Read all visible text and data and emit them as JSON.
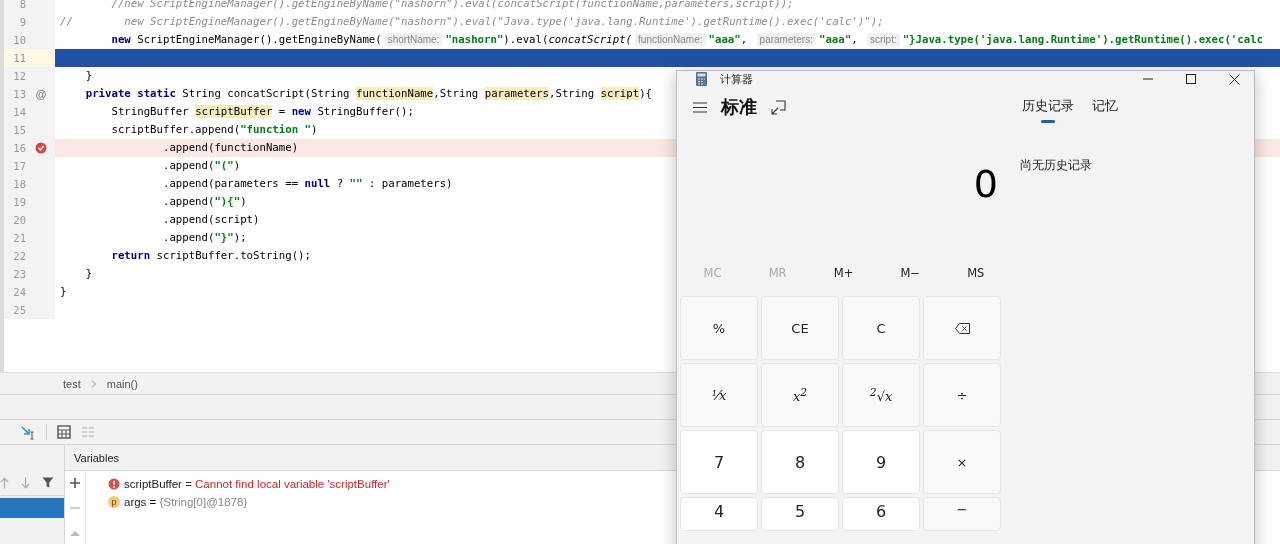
{
  "editor": {
    "lines": [
      {
        "number": "8",
        "kind": "plain",
        "tokens": [
          {
            "kind": "comment",
            "text": "        //new ScriptEngineManager().getEngineByName(\"nashorn\").eval(concatScript(functionName,parameters,script));"
          }
        ]
      },
      {
        "number": "9",
        "kind": "plain",
        "tokens": [
          {
            "kind": "comment",
            "text": "//        new ScriptEngineManager().getEngineByName(\"nashorn\").eval(\"Java.type('java.lang.Runtime').getRuntime().exec('calc')\");"
          }
        ]
      },
      {
        "number": "10",
        "kind": "plain",
        "tokens": [
          {
            "kind": "keyword",
            "text": "        new"
          },
          {
            "kind": "plain",
            "text": " ScriptEngineManager().getEngineByName("
          },
          {
            "kind": "hint",
            "text": "shortName:"
          },
          {
            "kind": "string",
            "text": "\"nashorn\""
          },
          {
            "kind": "plain",
            "text": ").eval("
          },
          {
            "kind": "italic",
            "text": "concatScript("
          },
          {
            "kind": "hint",
            "text": "functionName:"
          },
          {
            "kind": "string",
            "text": "\"aaa\""
          },
          {
            "kind": "plain",
            "text": ", "
          },
          {
            "kind": "hint",
            "text": "parameters:"
          },
          {
            "kind": "string",
            "text": "\"aaa\""
          },
          {
            "kind": "plain",
            "text": ", "
          },
          {
            "kind": "hint",
            "text": "script:"
          },
          {
            "kind": "string",
            "text": "\"}Java.type('java.lang.Runtime').getRuntime().exec('calc"
          }
        ]
      },
      {
        "number": "11",
        "kind": "current"
      },
      {
        "number": "12",
        "kind": "plain",
        "tokens": [
          {
            "kind": "plain",
            "text": "    }"
          }
        ]
      },
      {
        "number": "13",
        "kind": "plain",
        "gutter_text": "@",
        "tokens": [
          {
            "kind": "keyword",
            "text": "    private static"
          },
          {
            "kind": "plain",
            "text": " String concatScript(String "
          },
          {
            "kind": "highlight",
            "text": "functionName"
          },
          {
            "kind": "plain",
            "text": ",String "
          },
          {
            "kind": "highlight",
            "text": "parameters"
          },
          {
            "kind": "plain",
            "text": ",String "
          },
          {
            "kind": "highlight",
            "text": "script"
          },
          {
            "kind": "plain",
            "text": "){"
          }
        ]
      },
      {
        "number": "14",
        "kind": "plain",
        "tokens": [
          {
            "kind": "plain",
            "text": "        StringBuffer "
          },
          {
            "kind": "highlight",
            "text": "scriptBuffer"
          },
          {
            "kind": "plain",
            "text": " = "
          },
          {
            "kind": "keyword",
            "text": "new"
          },
          {
            "kind": "plain",
            "text": " StringBuffer();"
          }
        ]
      },
      {
        "number": "15",
        "kind": "plain",
        "tokens": [
          {
            "kind": "plain",
            "text": "        scriptBuffer.append("
          },
          {
            "kind": "string",
            "text": "\"function \""
          },
          {
            "kind": "plain",
            "text": ")"
          }
        ]
      },
      {
        "number": "16",
        "kind": "breakpoint",
        "tokens": [
          {
            "kind": "plain",
            "text": "                .append(functionName)"
          }
        ]
      },
      {
        "number": "17",
        "kind": "plain",
        "tokens": [
          {
            "kind": "plain",
            "text": "                .append("
          },
          {
            "kind": "string",
            "text": "\"(\""
          },
          {
            "kind": "plain",
            "text": ")"
          }
        ]
      },
      {
        "number": "18",
        "kind": "plain",
        "tokens": [
          {
            "kind": "plain",
            "text": "                .append(parameters == "
          },
          {
            "kind": "keyword",
            "text": "null"
          },
          {
            "kind": "plain",
            "text": " ? "
          },
          {
            "kind": "string",
            "text": "\"\""
          },
          {
            "kind": "plain",
            "text": " : parameters)"
          }
        ]
      },
      {
        "number": "19",
        "kind": "plain",
        "tokens": [
          {
            "kind": "plain",
            "text": "                .append("
          },
          {
            "kind": "string",
            "text": "\"){\""
          },
          {
            "kind": "plain",
            "text": ")"
          }
        ]
      },
      {
        "number": "20",
        "kind": "plain",
        "tokens": [
          {
            "kind": "plain",
            "text": "                .append(script)"
          }
        ]
      },
      {
        "number": "21",
        "kind": "plain",
        "tokens": [
          {
            "kind": "plain",
            "text": "                .append("
          },
          {
            "kind": "string",
            "text": "\"}\""
          },
          {
            "kind": "plain",
            "text": ");"
          }
        ]
      },
      {
        "number": "22",
        "kind": "plain",
        "tokens": [
          {
            "kind": "keyword",
            "text": "        return"
          },
          {
            "kind": "plain",
            "text": " scriptBuffer.toString();"
          }
        ]
      },
      {
        "number": "23",
        "kind": "plain",
        "tokens": [
          {
            "kind": "plain",
            "text": "    }"
          }
        ]
      },
      {
        "number": "24",
        "kind": "plain",
        "tokens": [
          {
            "kind": "plain",
            "text": "}"
          }
        ]
      },
      {
        "number": "25",
        "kind": "plain"
      }
    ]
  },
  "breadcrumb": [
    "test",
    "main()"
  ],
  "debugger": {
    "variables_title": "Variables",
    "variables": [
      {
        "kind": "error",
        "name": "scriptBuffer",
        "separator": "=",
        "value": "Cannot find local variable 'scriptBuffer'"
      },
      {
        "kind": "param",
        "badge": "p",
        "name": "args",
        "separator": "=",
        "value": "{String[0]@1878}"
      }
    ]
  },
  "calculator": {
    "title": "计算器",
    "mode": "标准",
    "tabs": [
      {
        "label": "历史记录",
        "selected": true
      },
      {
        "label": "记忆",
        "selected": false
      }
    ],
    "history_empty": "尚无历史记录",
    "display": "0",
    "memory": [
      {
        "label": "MC",
        "disabled": true
      },
      {
        "label": "MR",
        "disabled": true
      },
      {
        "label": "M+",
        "disabled": false
      },
      {
        "label": "M−",
        "disabled": false
      },
      {
        "label": "MS",
        "disabled": false
      }
    ],
    "keys": [
      {
        "kind": "op",
        "label": "%"
      },
      {
        "kind": "op",
        "label": "CE"
      },
      {
        "kind": "op",
        "label": "C"
      },
      {
        "kind": "backspace"
      },
      {
        "kind": "fn",
        "label": "⅟x"
      },
      {
        "kind": "fn",
        "label": "x$^{2}$"
      },
      {
        "kind": "fn",
        "label": "$^{2}$√x"
      },
      {
        "kind": "op",
        "label": "÷"
      },
      {
        "kind": "digit",
        "label": "7"
      },
      {
        "kind": "digit",
        "label": "8"
      },
      {
        "kind": "digit",
        "label": "9"
      },
      {
        "kind": "op",
        "label": "×"
      },
      {
        "kind": "digit",
        "label": "4"
      },
      {
        "kind": "digit",
        "label": "5"
      },
      {
        "kind": "digit",
        "label": "6"
      },
      {
        "kind": "op",
        "label": "−"
      }
    ]
  }
}
